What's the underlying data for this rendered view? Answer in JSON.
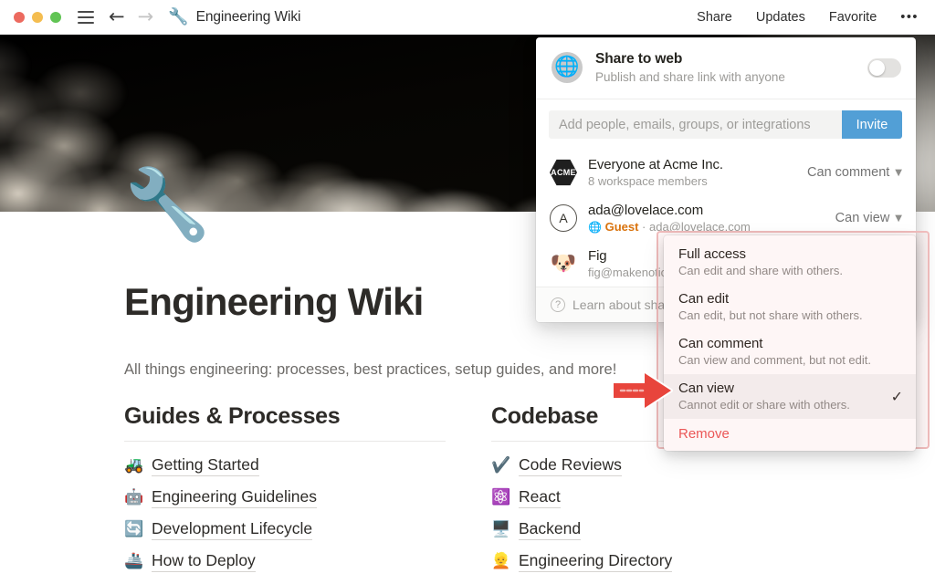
{
  "titlebar": {
    "traffic_lights": [
      "close",
      "minimize",
      "zoom"
    ],
    "menu_icon": "hamburger-icon",
    "back_icon": "←",
    "forward_icon": "→",
    "page_emoji": "🔧",
    "page_title": "Engineering Wiki",
    "actions": [
      "Share",
      "Updates",
      "Favorite"
    ],
    "more_icon": "•••"
  },
  "hero": {
    "page_icon_emoji": "🔧",
    "description": "rocket-launch-cover-photo"
  },
  "document": {
    "title": "Engineering Wiki",
    "subtitle": "All things engineering: processes, best practices, setup guides, and more!",
    "columns": [
      {
        "heading": "Guides & Processes",
        "links": [
          {
            "emoji": "🚜",
            "icon_name": "tractor-icon",
            "label": "Getting Started"
          },
          {
            "emoji": "🤖",
            "icon_name": "robot-icon",
            "label": "Engineering Guidelines"
          },
          {
            "emoji": "🔄",
            "icon_name": "refresh-icon",
            "label": "Development Lifecycle"
          },
          {
            "emoji": "🚢",
            "icon_name": "ship-icon",
            "label": "How to Deploy"
          }
        ]
      },
      {
        "heading": "Codebase",
        "links": [
          {
            "emoji": "✔️",
            "icon_name": "check-icon",
            "label": "Code Reviews"
          },
          {
            "emoji": "⚛️",
            "icon_name": "atom-icon",
            "label": "React"
          },
          {
            "emoji": "🖥️",
            "icon_name": "desktop-computer-icon",
            "label": "Backend"
          },
          {
            "emoji": "👱",
            "icon_name": "person-icon",
            "label": "Engineering Directory"
          }
        ]
      }
    ]
  },
  "share_panel": {
    "web": {
      "icon_name": "globe-icon",
      "title": "Share to web",
      "subtitle": "Publish and share link with anyone",
      "toggle_state": "off"
    },
    "invite": {
      "placeholder": "Add people, emails, groups, or integrations",
      "value": "",
      "button_label": "Invite"
    },
    "people": [
      {
        "avatar_type": "acme-logo",
        "avatar_text": "ACME",
        "name": "Everyone at Acme Inc.",
        "detail": "8 workspace members",
        "permission": "Can comment"
      },
      {
        "avatar_type": "letter",
        "avatar_text": "A",
        "name": "ada@lovelace.com",
        "badge": "Guest",
        "badge_icon": "globe-icon",
        "detail_separator": "·",
        "detail": "ada@lovelace.com",
        "permission": "Can view"
      },
      {
        "avatar_type": "emoji",
        "avatar_text": "🐶",
        "name": "Fig",
        "detail": "fig@makenotio",
        "permission": ""
      }
    ],
    "footer": {
      "icon_name": "question-mark-icon",
      "label": "Learn about sharing"
    }
  },
  "permission_menu": {
    "items": [
      {
        "title": "Full access",
        "desc": "Can edit and share with others.",
        "selected": false
      },
      {
        "title": "Can edit",
        "desc": "Can edit, but not share with others.",
        "selected": false
      },
      {
        "title": "Can comment",
        "desc": "Can view and comment, but not edit.",
        "selected": false
      },
      {
        "title": "Can view",
        "desc": "Cannot edit or share with others.",
        "selected": true
      }
    ],
    "check_glyph": "✓",
    "remove_label": "Remove"
  },
  "annotation": {
    "arrow_color": "#e8453c",
    "highlight_border": "#f0bcbc",
    "points_at": "Can view"
  }
}
